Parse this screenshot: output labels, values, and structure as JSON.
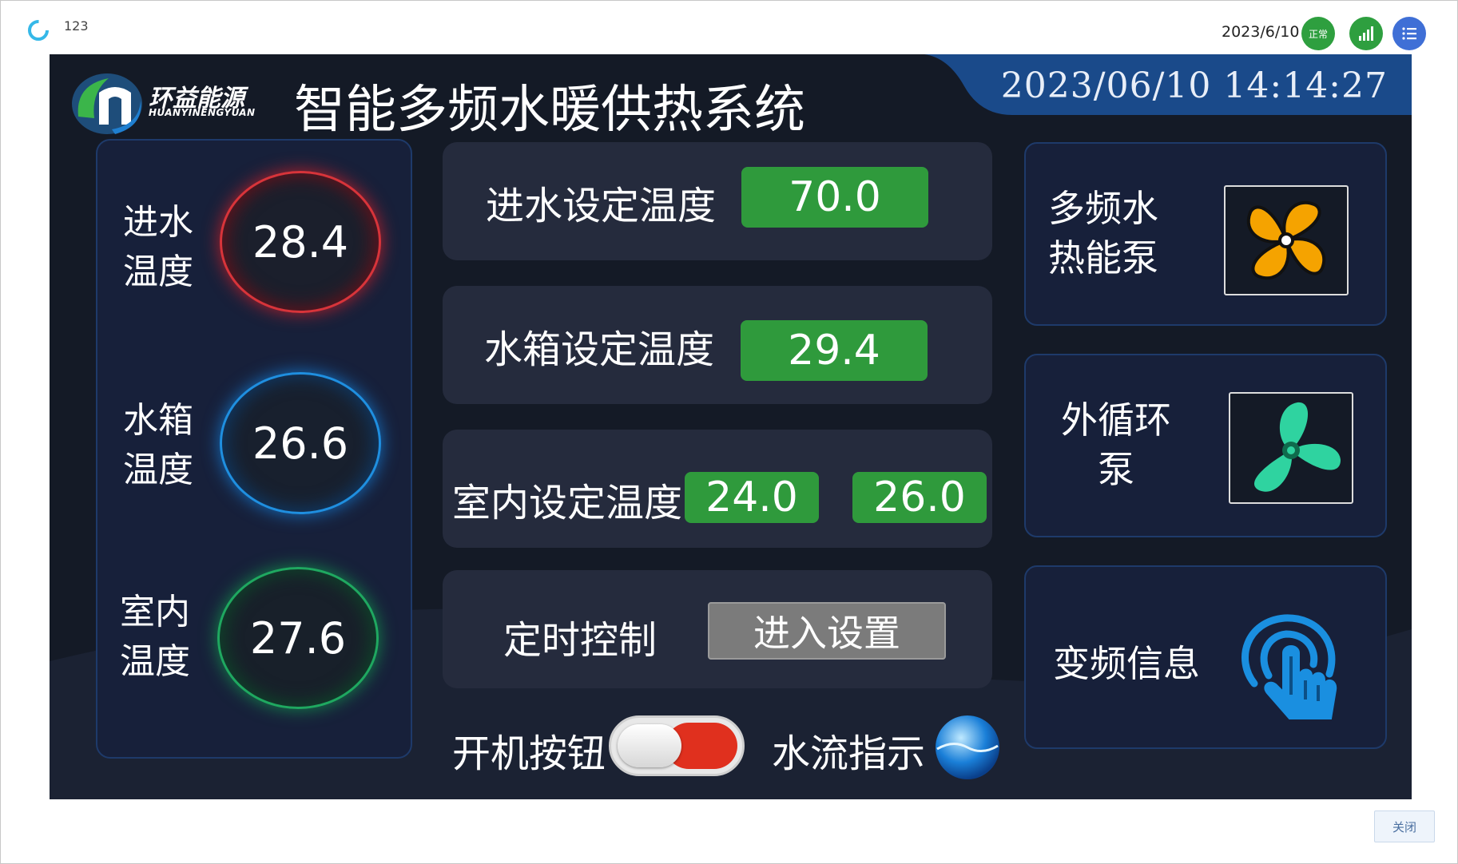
{
  "topbar": {
    "id_text": "123",
    "date": "2023/6/10",
    "status_badge": "正常"
  },
  "hmi": {
    "logo_text": "环益能源",
    "logo_sub": "HUANYINENGYUAN",
    "title": "智能多频水暖供热系统",
    "datetime": "2023/06/10  14:14:27",
    "gauges": [
      {
        "label_line1": "进水",
        "label_line2": "温度",
        "value": "28.4",
        "color": "#d8343a"
      },
      {
        "label_line1": "水箱",
        "label_line2": "温度",
        "value": "26.6",
        "color": "#1f8fe0"
      },
      {
        "label_line1": "室内",
        "label_line2": "温度",
        "value": "27.6",
        "color": "#1fa860"
      }
    ],
    "inlet_setpoint": {
      "label": "进水设定温度",
      "value": "70.0"
    },
    "tank_setpoint": {
      "label": "水箱设定温度",
      "value": "29.4"
    },
    "indoor_setpoint": {
      "label": "室内设定温度",
      "value_low": "24.0",
      "value_high": "26.0"
    },
    "timer_control": {
      "label": "定时控制",
      "button": "进入设置"
    },
    "power": {
      "label": "开机按钮"
    },
    "water_flow": {
      "label": "水流指示"
    },
    "right_cards": {
      "heat_pump": {
        "line1": "多频水",
        "line2": "热能泵"
      },
      "circulation_pump": {
        "line1": "外循环",
        "line2": "泵"
      },
      "vfd_info": {
        "label": "变频信息"
      }
    },
    "colors": {
      "setpoint_green": "#2f9a3c",
      "fan_yellow": "#f5a300",
      "fan_teal": "#2fd3a0",
      "touch_blue": "#1a8fe0"
    }
  },
  "footer": {
    "close_label": "关闭"
  }
}
